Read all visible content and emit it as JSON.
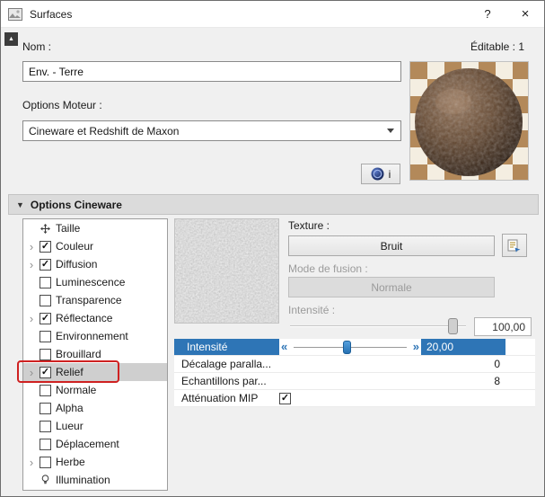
{
  "window": {
    "title": "Surfaces",
    "help_glyph": "?",
    "close_glyph": "×",
    "pin_glyph": "▲"
  },
  "header": {
    "name_label": "Nom :",
    "editable_label": "Éditable : 1",
    "name_value": "Env. - Terre",
    "engine_label": "Options Moteur :",
    "engine_value": "Cineware et Redshift de Maxon",
    "info_label": "i"
  },
  "section": {
    "title": "Options Cineware",
    "collapse_glyph": "▼"
  },
  "tree": {
    "items": [
      {
        "id": "taille",
        "label": "Taille",
        "icon": "size",
        "expander": false,
        "checkbox": "none",
        "selected": false
      },
      {
        "id": "couleur",
        "label": "Couleur",
        "icon": null,
        "expander": true,
        "checkbox": "checked",
        "selected": false
      },
      {
        "id": "diffusion",
        "label": "Diffusion",
        "icon": null,
        "expander": true,
        "checkbox": "checked",
        "selected": false
      },
      {
        "id": "luminescence",
        "label": "Luminescence",
        "icon": null,
        "expander": false,
        "checkbox": "unchecked",
        "selected": false
      },
      {
        "id": "transparence",
        "label": "Transparence",
        "icon": null,
        "expander": false,
        "checkbox": "unchecked",
        "selected": false
      },
      {
        "id": "reflectance",
        "label": "Réflectance",
        "icon": null,
        "expander": true,
        "checkbox": "checked",
        "selected": false
      },
      {
        "id": "environnement",
        "label": "Environnement",
        "icon": null,
        "expander": false,
        "checkbox": "unchecked",
        "selected": false
      },
      {
        "id": "brouillard",
        "label": "Brouillard",
        "icon": null,
        "expander": false,
        "checkbox": "unchecked",
        "selected": false
      },
      {
        "id": "relief",
        "label": "Relief",
        "icon": null,
        "expander": true,
        "checkbox": "checked",
        "selected": true
      },
      {
        "id": "normale",
        "label": "Normale",
        "icon": null,
        "expander": false,
        "checkbox": "unchecked",
        "selected": false
      },
      {
        "id": "alpha",
        "label": "Alpha",
        "icon": null,
        "expander": false,
        "checkbox": "unchecked",
        "selected": false
      },
      {
        "id": "lueur",
        "label": "Lueur",
        "icon": null,
        "expander": false,
        "checkbox": "unchecked",
        "selected": false
      },
      {
        "id": "deplacement",
        "label": "Déplacement",
        "icon": null,
        "expander": false,
        "checkbox": "unchecked",
        "selected": false
      },
      {
        "id": "herbe",
        "label": "Herbe",
        "icon": null,
        "expander": true,
        "checkbox": "unchecked",
        "selected": false
      },
      {
        "id": "illumination",
        "label": "Illumination",
        "icon": "bulb",
        "expander": false,
        "checkbox": "none",
        "selected": false
      }
    ]
  },
  "panel": {
    "texture_label": "Texture :",
    "texture_button": "Bruit",
    "fusion_label": "Mode de fusion :",
    "fusion_value": "Normale",
    "intensity_label": "Intensité :",
    "intensity_value": "100,00"
  },
  "table": {
    "rows": [
      {
        "label": "Intensité",
        "value": "20,00"
      },
      {
        "label": "Décalage paralla...",
        "value": "0"
      },
      {
        "label": "Echantillons par...",
        "value": "8"
      },
      {
        "label": "Atténuation MIP",
        "checked": true
      }
    ]
  },
  "colors": {
    "accent": "#2e75b6",
    "annotation": "#cf2121"
  }
}
